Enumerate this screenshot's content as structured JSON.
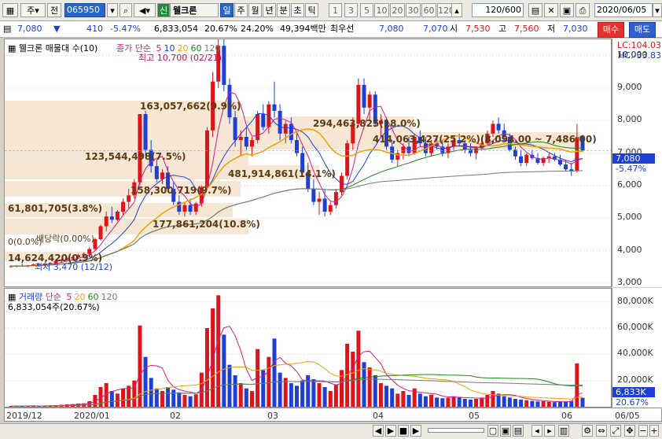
{
  "toolbar": {
    "market": "주",
    "period_btn": "전",
    "stock_code": "065950",
    "stock_badge": "신",
    "stock_name": "웰크론",
    "periods": [
      "일",
      "주",
      "월",
      "년",
      "분",
      "초",
      "틱"
    ],
    "intervals": [
      "1",
      "3",
      "5",
      "10",
      "20",
      "30",
      "60",
      "120"
    ],
    "count": "120/600",
    "date": "2020/06/05"
  },
  "quote": {
    "price": "7,080",
    "change": "410",
    "change_pct": "-5.47%",
    "volume": "6,833,054",
    "volume_pct": "20.67%",
    "turnover_pct": "24.20%",
    "amount": "49,394백만",
    "best_ask_label": "최우선",
    "best_ask": "7,080",
    "best_bid": "7,070",
    "open_label": "시",
    "open": "7,530",
    "high_label": "고",
    "high": "7,560",
    "low_label": "저",
    "low": "7,030",
    "buy_btn": "매수",
    "sell_btn": "매도"
  },
  "price_chart": {
    "title": "웰크론 매물대 수(10)",
    "legend_label": "종가 단순",
    "ma_periods": [
      "5",
      "10",
      "20",
      "60",
      "120"
    ],
    "ma_colors": [
      "#d31c8a",
      "#1d3fd6",
      "#f0a000",
      "#1a8a1a",
      "#777777"
    ],
    "lc": "LC:104.03",
    "hc": "HC:-33.83",
    "high_note": "최고 10,700 (02/21)",
    "low_note": "최저 3,470 (12/12)",
    "current_price_tag": "7,080",
    "current_pct_tag": "-5.47%",
    "ex_dividend": "배당락(0.00%)",
    "zero_label": "0(0.0%)",
    "y_ticks": [
      "10,000",
      "9,000",
      "8,000",
      "7,000",
      "6,000",
      "5,000",
      "4,000",
      "3,000"
    ],
    "volume_profile": [
      {
        "label": "163,057,662(9.9%)"
      },
      {
        "label": "294,463,825(18.0%)"
      },
      {
        "label": "414,063,427(25.2%)(8,094.00 ~ 7,486.00)"
      },
      {
        "label": "123,544,498(7.5%)"
      },
      {
        "label": "481,914,861(14.1%)"
      },
      {
        "label": "158,300,719(9.7%)"
      },
      {
        "label": "61,801,705(3.8%)"
      },
      {
        "label": "177,861,204(10.8%)"
      },
      {
        "label": "14,624,420(0.9%)"
      }
    ]
  },
  "volume_chart": {
    "title": "거래량",
    "legend_label": "단순",
    "ma_periods": [
      "5",
      "20",
      "60",
      "120"
    ],
    "current_volume": "6,833,054주(20.67%)",
    "y_ticks": [
      "80,000K",
      "60,000K",
      "40,000K",
      "20,000K"
    ],
    "current_tag": "6,833K",
    "pct_tag": "20.67%"
  },
  "x_axis": [
    "2019/12",
    "2020/01",
    "02",
    "03",
    "04",
    "05",
    "06",
    "06/05"
  ],
  "colors": {
    "up": "#e0121a",
    "down": "#1d3fd6",
    "band": "#f6e6d4"
  },
  "chart_data": {
    "type": "candlestick",
    "title": "웰크론",
    "ylim": [
      3000,
      10500
    ],
    "volume_ylim": [
      0,
      90000
    ],
    "y_unit": "KRW",
    "volume_unit": "K shares",
    "candles": [
      {
        "o": 3500,
        "h": 3550,
        "l": 3470,
        "c": 3520,
        "v": 600
      },
      {
        "o": 3520,
        "h": 3560,
        "l": 3480,
        "c": 3540,
        "v": 500
      },
      {
        "o": 3540,
        "h": 3600,
        "l": 3500,
        "c": 3510,
        "v": 700
      },
      {
        "o": 3510,
        "h": 3560,
        "l": 3490,
        "c": 3550,
        "v": 600
      },
      {
        "o": 3550,
        "h": 3600,
        "l": 3520,
        "c": 3580,
        "v": 800
      },
      {
        "o": 3580,
        "h": 3620,
        "l": 3540,
        "c": 3560,
        "v": 500
      },
      {
        "o": 3560,
        "h": 3620,
        "l": 3530,
        "c": 3600,
        "v": 700
      },
      {
        "o": 3600,
        "h": 3650,
        "l": 3560,
        "c": 3620,
        "v": 900
      },
      {
        "o": 3620,
        "h": 3700,
        "l": 3600,
        "c": 3680,
        "v": 1200
      },
      {
        "o": 3680,
        "h": 3750,
        "l": 3640,
        "c": 3720,
        "v": 1500
      },
      {
        "o": 3720,
        "h": 3800,
        "l": 3680,
        "c": 3760,
        "v": 1800
      },
      {
        "o": 3760,
        "h": 3850,
        "l": 3720,
        "c": 3800,
        "v": 2000
      },
      {
        "o": 3800,
        "h": 3900,
        "l": 3750,
        "c": 3860,
        "v": 2400
      },
      {
        "o": 3860,
        "h": 3950,
        "l": 3800,
        "c": 3900,
        "v": 2600
      },
      {
        "o": 3900,
        "h": 4100,
        "l": 3860,
        "c": 4050,
        "v": 4200
      },
      {
        "o": 4050,
        "h": 4400,
        "l": 4000,
        "c": 4350,
        "v": 9000
      },
      {
        "o": 4350,
        "h": 4800,
        "l": 4300,
        "c": 4750,
        "v": 15000
      },
      {
        "o": 4750,
        "h": 5200,
        "l": 4600,
        "c": 5050,
        "v": 18000
      },
      {
        "o": 5050,
        "h": 5350,
        "l": 4850,
        "c": 4950,
        "v": 12000
      },
      {
        "o": 4950,
        "h": 5250,
        "l": 4900,
        "c": 5200,
        "v": 10000
      },
      {
        "o": 5200,
        "h": 5600,
        "l": 5100,
        "c": 5500,
        "v": 14000
      },
      {
        "o": 5500,
        "h": 5900,
        "l": 5300,
        "c": 5700,
        "v": 16000
      },
      {
        "o": 5700,
        "h": 6200,
        "l": 5600,
        "c": 6100,
        "v": 20000
      },
      {
        "o": 6100,
        "h": 8200,
        "l": 6000,
        "c": 8200,
        "v": 62000
      },
      {
        "o": 8200,
        "h": 8300,
        "l": 6900,
        "c": 7100,
        "v": 38000
      },
      {
        "o": 7100,
        "h": 7400,
        "l": 6400,
        "c": 6600,
        "v": 22000
      },
      {
        "o": 6600,
        "h": 6800,
        "l": 6100,
        "c": 6200,
        "v": 14000
      },
      {
        "o": 6200,
        "h": 6500,
        "l": 6050,
        "c": 6400,
        "v": 12000
      },
      {
        "o": 6400,
        "h": 6600,
        "l": 5800,
        "c": 5900,
        "v": 15000
      },
      {
        "o": 5900,
        "h": 6100,
        "l": 5400,
        "c": 5500,
        "v": 13000
      },
      {
        "o": 5500,
        "h": 5700,
        "l": 5100,
        "c": 5200,
        "v": 11000
      },
      {
        "o": 5200,
        "h": 5500,
        "l": 5050,
        "c": 5400,
        "v": 9000
      },
      {
        "o": 5400,
        "h": 5600,
        "l": 5100,
        "c": 5200,
        "v": 8000
      },
      {
        "o": 5200,
        "h": 5500,
        "l": 5100,
        "c": 5450,
        "v": 9500
      },
      {
        "o": 5450,
        "h": 6000,
        "l": 5350,
        "c": 5950,
        "v": 26000
      },
      {
        "o": 5950,
        "h": 7800,
        "l": 5900,
        "c": 7700,
        "v": 60000
      },
      {
        "o": 7700,
        "h": 9500,
        "l": 7500,
        "c": 9200,
        "v": 75000
      },
      {
        "o": 9200,
        "h": 10700,
        "l": 9000,
        "c": 10300,
        "v": 85000
      },
      {
        "o": 10300,
        "h": 10500,
        "l": 8900,
        "c": 9100,
        "v": 55000
      },
      {
        "o": 9100,
        "h": 9300,
        "l": 7900,
        "c": 8100,
        "v": 32000
      },
      {
        "o": 8100,
        "h": 8300,
        "l": 7200,
        "c": 7400,
        "v": 24000
      },
      {
        "o": 7400,
        "h": 7700,
        "l": 6900,
        "c": 7500,
        "v": 18000
      },
      {
        "o": 7500,
        "h": 7800,
        "l": 7100,
        "c": 7200,
        "v": 14000
      },
      {
        "o": 7200,
        "h": 7500,
        "l": 6900,
        "c": 7400,
        "v": 12000
      },
      {
        "o": 7400,
        "h": 8300,
        "l": 7300,
        "c": 8200,
        "v": 44000
      },
      {
        "o": 8200,
        "h": 8500,
        "l": 7700,
        "c": 7800,
        "v": 28000
      },
      {
        "o": 7800,
        "h": 8600,
        "l": 7600,
        "c": 8500,
        "v": 38000
      },
      {
        "o": 8500,
        "h": 9200,
        "l": 8100,
        "c": 8300,
        "v": 52000
      },
      {
        "o": 8300,
        "h": 8500,
        "l": 7400,
        "c": 7600,
        "v": 26000
      },
      {
        "o": 7600,
        "h": 8000,
        "l": 7300,
        "c": 7900,
        "v": 22000
      },
      {
        "o": 7900,
        "h": 8100,
        "l": 7300,
        "c": 7400,
        "v": 18000
      },
      {
        "o": 7400,
        "h": 7600,
        "l": 6900,
        "c": 7000,
        "v": 16000
      },
      {
        "o": 7000,
        "h": 7200,
        "l": 6300,
        "c": 6400,
        "v": 20000
      },
      {
        "o": 6400,
        "h": 6700,
        "l": 5800,
        "c": 5900,
        "v": 24000
      },
      {
        "o": 5900,
        "h": 6200,
        "l": 5400,
        "c": 5500,
        "v": 21000
      },
      {
        "o": 5500,
        "h": 5800,
        "l": 5100,
        "c": 5600,
        "v": 18000
      },
      {
        "o": 5600,
        "h": 5900,
        "l": 5050,
        "c": 5200,
        "v": 15000
      },
      {
        "o": 5200,
        "h": 5500,
        "l": 5100,
        "c": 5400,
        "v": 12000
      },
      {
        "o": 5400,
        "h": 5900,
        "l": 5300,
        "c": 5800,
        "v": 17000
      },
      {
        "o": 5800,
        "h": 6400,
        "l": 5700,
        "c": 6300,
        "v": 28000
      },
      {
        "o": 6300,
        "h": 7400,
        "l": 6200,
        "c": 7300,
        "v": 48000
      },
      {
        "o": 7300,
        "h": 8100,
        "l": 7100,
        "c": 7900,
        "v": 42000
      },
      {
        "o": 7900,
        "h": 9300,
        "l": 7800,
        "c": 9100,
        "v": 58000
      },
      {
        "o": 9100,
        "h": 9300,
        "l": 8200,
        "c": 8400,
        "v": 34000
      },
      {
        "o": 8400,
        "h": 8900,
        "l": 8000,
        "c": 8800,
        "v": 30000
      },
      {
        "o": 8800,
        "h": 8900,
        "l": 7800,
        "c": 7900,
        "v": 24000
      },
      {
        "o": 7900,
        "h": 8200,
        "l": 7500,
        "c": 8000,
        "v": 18000
      },
      {
        "o": 8000,
        "h": 8100,
        "l": 7100,
        "c": 7200,
        "v": 16000
      },
      {
        "o": 7200,
        "h": 7400,
        "l": 6700,
        "c": 6800,
        "v": 14000
      },
      {
        "o": 6800,
        "h": 7100,
        "l": 6600,
        "c": 7000,
        "v": 10000
      },
      {
        "o": 7000,
        "h": 7300,
        "l": 6800,
        "c": 7200,
        "v": 12000
      },
      {
        "o": 7200,
        "h": 7500,
        "l": 6900,
        "c": 7000,
        "v": 9000
      },
      {
        "o": 7000,
        "h": 7600,
        "l": 6950,
        "c": 7500,
        "v": 14000
      },
      {
        "o": 7500,
        "h": 7700,
        "l": 7200,
        "c": 7300,
        "v": 10000
      },
      {
        "o": 7300,
        "h": 7500,
        "l": 6900,
        "c": 7000,
        "v": 8000
      },
      {
        "o": 7000,
        "h": 7400,
        "l": 6900,
        "c": 7300,
        "v": 9000
      },
      {
        "o": 7300,
        "h": 7500,
        "l": 7100,
        "c": 7200,
        "v": 7000
      },
      {
        "o": 7200,
        "h": 7400,
        "l": 6900,
        "c": 7000,
        "v": 6500
      },
      {
        "o": 7000,
        "h": 7300,
        "l": 6850,
        "c": 7200,
        "v": 7000
      },
      {
        "o": 7200,
        "h": 7500,
        "l": 7100,
        "c": 7400,
        "v": 8000
      },
      {
        "o": 7400,
        "h": 7600,
        "l": 7200,
        "c": 7300,
        "v": 7500
      },
      {
        "o": 7300,
        "h": 7400,
        "l": 7000,
        "c": 7100,
        "v": 6000
      },
      {
        "o": 7100,
        "h": 7300,
        "l": 6900,
        "c": 7000,
        "v": 5500
      },
      {
        "o": 7000,
        "h": 7200,
        "l": 6800,
        "c": 7150,
        "v": 6000
      },
      {
        "o": 7150,
        "h": 7400,
        "l": 7100,
        "c": 7300,
        "v": 7000
      },
      {
        "o": 7300,
        "h": 7700,
        "l": 7250,
        "c": 7600,
        "v": 9000
      },
      {
        "o": 7600,
        "h": 8000,
        "l": 7500,
        "c": 7900,
        "v": 12000
      },
      {
        "o": 7900,
        "h": 8100,
        "l": 7600,
        "c": 7700,
        "v": 10000
      },
      {
        "o": 7700,
        "h": 7900,
        "l": 7400,
        "c": 7500,
        "v": 8000
      },
      {
        "o": 7500,
        "h": 7600,
        "l": 7050,
        "c": 7100,
        "v": 7000
      },
      {
        "o": 7100,
        "h": 7200,
        "l": 6800,
        "c": 6900,
        "v": 6000
      },
      {
        "o": 6900,
        "h": 7100,
        "l": 6600,
        "c": 6700,
        "v": 5500
      },
      {
        "o": 6700,
        "h": 7000,
        "l": 6600,
        "c": 6950,
        "v": 5000
      },
      {
        "o": 6950,
        "h": 7100,
        "l": 6800,
        "c": 6850,
        "v": 4500
      },
      {
        "o": 6850,
        "h": 7000,
        "l": 6650,
        "c": 6700,
        "v": 4000
      },
      {
        "o": 6700,
        "h": 6900,
        "l": 6600,
        "c": 6850,
        "v": 4200
      },
      {
        "o": 6850,
        "h": 7000,
        "l": 6700,
        "c": 6900,
        "v": 3800
      },
      {
        "o": 6900,
        "h": 7000,
        "l": 6750,
        "c": 6800,
        "v": 3500
      },
      {
        "o": 6800,
        "h": 6950,
        "l": 6600,
        "c": 6650,
        "v": 3600
      },
      {
        "o": 6650,
        "h": 6800,
        "l": 6450,
        "c": 6500,
        "v": 4000
      },
      {
        "o": 6500,
        "h": 6700,
        "l": 6300,
        "c": 6450,
        "v": 4500
      },
      {
        "o": 6450,
        "h": 7900,
        "l": 6400,
        "c": 7490,
        "v": 33000
      },
      {
        "o": 7530,
        "h": 7560,
        "l": 7030,
        "c": 7080,
        "v": 6833
      }
    ]
  }
}
